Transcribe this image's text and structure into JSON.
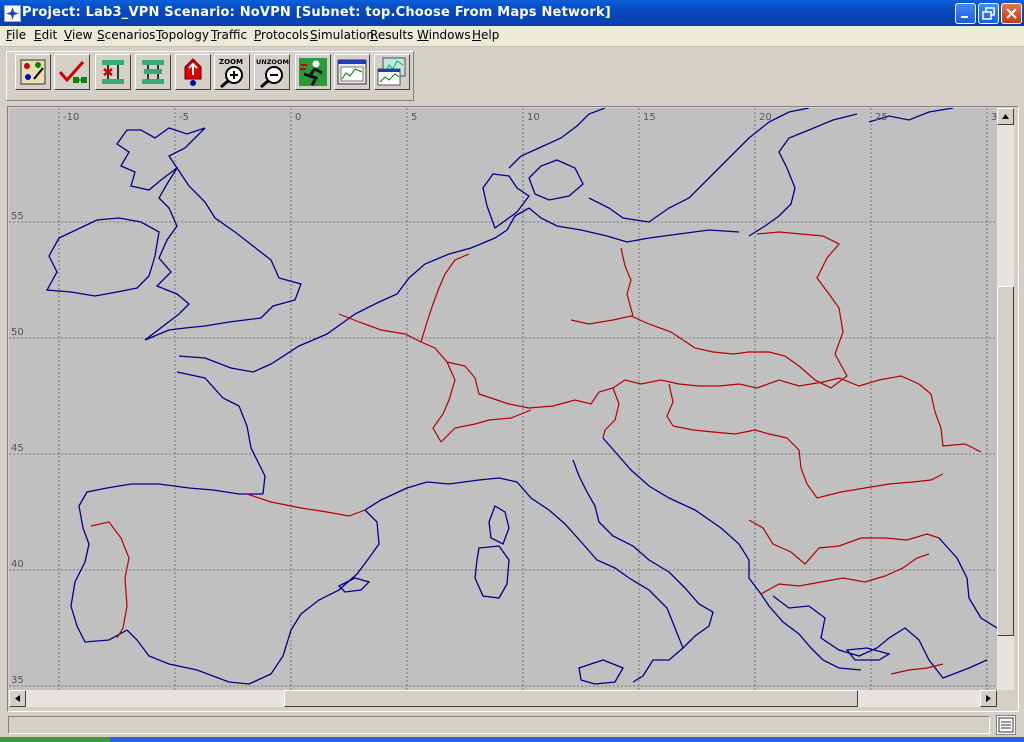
{
  "window": {
    "title": "Project: Lab3_VPN Scenario: NoVPN  [Subnet: top.Choose From Maps Network]"
  },
  "menu": {
    "items": [
      "File",
      "Edit",
      "View",
      "Scenarios",
      "Topology",
      "Traffic",
      "Protocols",
      "Simulation",
      "Results",
      "Windows",
      "Help"
    ]
  },
  "toolbar": {
    "buttons": [
      {
        "name": "open-object-palette",
        "icon": "palette-icon"
      },
      {
        "name": "check-links",
        "icon": "checkmark-links-icon"
      },
      {
        "name": "fail-link",
        "icon": "fail-link-icon"
      },
      {
        "name": "recover-link",
        "icon": "recover-link-icon"
      },
      {
        "name": "return-to-parent-subnet",
        "icon": "parent-subnet-icon"
      },
      {
        "name": "zoom",
        "icon": "zoom-in-icon",
        "label": "ZOOM"
      },
      {
        "name": "unzoom",
        "icon": "zoom-out-icon",
        "label": "UNZOOM"
      },
      {
        "name": "configure-run-simulation",
        "icon": "run-simulation-icon"
      },
      {
        "name": "view-results",
        "icon": "view-results-icon"
      },
      {
        "name": "hide-show-graphs",
        "icon": "graphs-icon"
      }
    ]
  },
  "map": {
    "longitude_labels": [
      "-10",
      "-5",
      "0",
      "5",
      "10",
      "15",
      "20",
      "25",
      "3"
    ],
    "latitude_labels": [
      "55",
      "50",
      "45",
      "40",
      "35"
    ],
    "coast_color": "#00008b",
    "border_color": "#b40000",
    "background_color": "#c0c0c0"
  },
  "colors": {
    "title_bar": "#0a4fd0",
    "chrome": "#d4d0c8"
  }
}
